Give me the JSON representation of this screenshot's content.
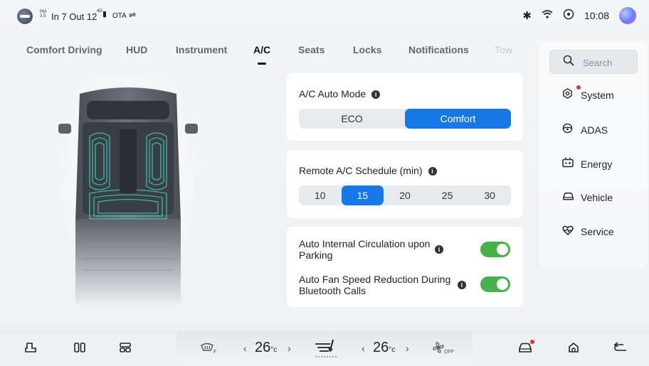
{
  "status_bar": {
    "ampm": "PM 3.5",
    "date_time": "In 7 Out 12",
    "signal": "4G",
    "ota": "OTA",
    "usb_icon": "usb-icon",
    "clock": "10:08"
  },
  "tabs": [
    {
      "label": "Comfort Driving"
    },
    {
      "label": "HUD"
    },
    {
      "label": "Instrument"
    },
    {
      "label": "A/C"
    },
    {
      "label": "Seats"
    },
    {
      "label": "Locks"
    },
    {
      "label": "Notifications"
    },
    {
      "label": "Tow"
    }
  ],
  "active_tab": "A/C",
  "ac_auto_mode": {
    "title": "A/C Auto Mode",
    "options": [
      "ECO",
      "Comfort"
    ],
    "selected": "Comfort"
  },
  "remote_schedule": {
    "title": "Remote A/C Schedule (min)",
    "options": [
      "10",
      "15",
      "20",
      "25",
      "30"
    ],
    "selected": "15"
  },
  "toggles": [
    {
      "label": "Auto Internal Circulation upon Parking",
      "on": true
    },
    {
      "label": "Auto Fan Speed Reduction During Bluetooth Calls",
      "on": true
    }
  ],
  "sidebar": {
    "search_placeholder": "Search",
    "items": [
      {
        "label": "System",
        "icon": "system-icon"
      },
      {
        "label": "ADAS",
        "icon": "steering-icon"
      },
      {
        "label": "Energy",
        "icon": "battery-icon"
      },
      {
        "label": "Vehicle",
        "icon": "car-icon"
      },
      {
        "label": "Service",
        "icon": "heart-icon"
      }
    ],
    "active": "Vehicle"
  },
  "dock": {
    "defrost_label": "F",
    "temp_left": "26",
    "temp_right": "26",
    "temp_unit": "°c",
    "fan_label": "OFF"
  },
  "colors": {
    "accent": "#1877e6",
    "toggle_on": "#48b04a",
    "notification_dot": "#e0333b"
  }
}
